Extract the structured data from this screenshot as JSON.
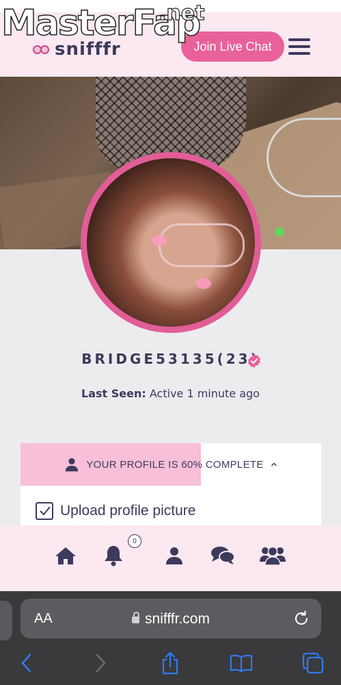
{
  "watermark": {
    "brand": "MasterFap",
    "tld": ".net"
  },
  "header": {
    "logo_text": "snifffr",
    "join_button": "Join Live Chat"
  },
  "profile": {
    "username": "BRIDGE53135(23)",
    "online": true,
    "last_seen_label": "Last Seen:",
    "last_seen_value": "Active 1 minute ago"
  },
  "completion": {
    "text": "YOUR PROFILE IS 60% COMPLETE",
    "percent": 60,
    "task_label": "Upload profile picture",
    "task_checked": true
  },
  "bottom_nav": {
    "items": [
      "home-icon",
      "bell-icon",
      "user-icon",
      "chat-icon",
      "group-icon"
    ],
    "notification_count": "0"
  },
  "browser": {
    "text_size": "AA",
    "url": "snifffr.com"
  },
  "colors": {
    "accent": "#e9619a",
    "header_bg": "#fbe8f0",
    "text_dark": "#3d3a5c",
    "online": "#5ddc5d",
    "ios_blue": "#2f7bf6"
  }
}
